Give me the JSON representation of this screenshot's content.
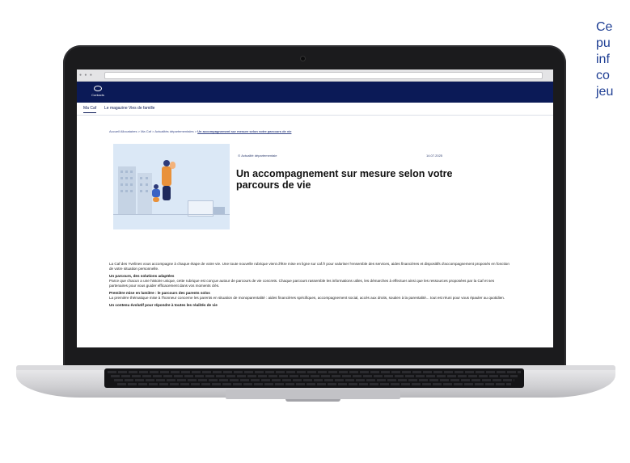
{
  "side_text": {
    "lines": [
      "Ce",
      "pu",
      "inf",
      "co",
      "jeu"
    ]
  },
  "site": {
    "logo_label": "Contacts",
    "nav": [
      "Ma Caf",
      "Le magazine Vies de famille"
    ],
    "breadcrumb": {
      "items": [
        "Accueil Allocataires",
        "Ma Caf",
        "Actualités départementales"
      ],
      "separator": ">",
      "current": "Un accompagnement sur mesure selon votre parcours de vie"
    },
    "article": {
      "badge": "Actualité départementale",
      "date": "14.07.2025",
      "title": "Un accompagnement sur mesure selon votre parcours de vie",
      "paragraphs": [
        {
          "heading": "",
          "text": "La Caf des Yvelines vous accompagne à chaque étape de votre vie. Une toute nouvelle rubrique vient d'être mise en ligne sur caf.fr pour valoriser l'ensemble des services, aides financières et dispositifs d'accompagnement proposés en fonction de votre situation personnelle."
        },
        {
          "heading": "Un parcours, des solutions adaptées",
          "text": "Parce que chacun a une histoire unique, cette rubrique est conçue autour de parcours de vie concrets. Chaque parcours rassemble les informations utiles, les démarches à effectuer ainsi que les ressources proposées par la Caf et ses partenaires pour vous guider efficacement dans vos moments clés."
        },
        {
          "heading": "Première mise en lumière : le parcours des parents solos",
          "text": "La première thématique mise à l'honneur concerne les parents en situation de monoparentalité : aides financières spécifiques, accompagnement social, accès aux droits, soutien à la parentalité... tout est réuni pour vous épauler au quotidien."
        },
        {
          "heading": "Un contenu évolutif pour répondre à toutes les réalités de vie",
          "text": ""
        }
      ]
    }
  },
  "colors": {
    "header_bg": "#0b1a57",
    "side_text": "#1f3f94",
    "hero_bg": "#dbe8f6"
  }
}
